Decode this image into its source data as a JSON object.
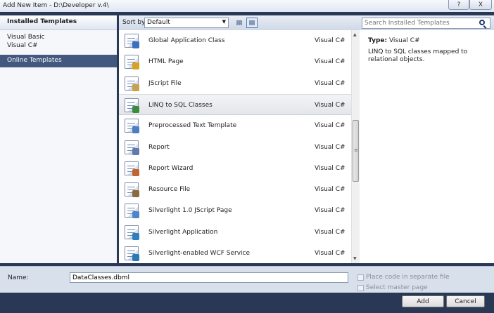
{
  "window": {
    "title": "Add New Item - D:\\Developer v.4\\",
    "help_label": "?",
    "close_label": "X"
  },
  "left_pane": {
    "installed_header": "Installed Templates",
    "tree": [
      "Visual Basic",
      "Visual C#"
    ],
    "online_templates": "Online Templates"
  },
  "sortbar": {
    "sort_label": "Sort by:",
    "sort_value": "Default"
  },
  "items": [
    {
      "name": "Global Application Class",
      "lang": "Visual C#",
      "icon": "global-app-icon"
    },
    {
      "name": "HTML Page",
      "lang": "Visual C#",
      "icon": "html-page-icon"
    },
    {
      "name": "JScript File",
      "lang": "Visual C#",
      "icon": "jscript-file-icon"
    },
    {
      "name": "LINQ to SQL Classes",
      "lang": "Visual C#",
      "icon": "linq-sql-icon"
    },
    {
      "name": "Preprocessed Text Template",
      "lang": "Visual C#",
      "icon": "text-template-icon"
    },
    {
      "name": "Report",
      "lang": "Visual C#",
      "icon": "report-icon"
    },
    {
      "name": "Report Wizard",
      "lang": "Visual C#",
      "icon": "report-wizard-icon"
    },
    {
      "name": "Resource File",
      "lang": "Visual C#",
      "icon": "resource-file-icon"
    },
    {
      "name": "Silverlight 1.0 JScript Page",
      "lang": "Visual C#",
      "icon": "silverlight-jscript-icon"
    },
    {
      "name": "Silverlight Application",
      "lang": "Visual C#",
      "icon": "silverlight-app-icon"
    },
    {
      "name": "Silverlight-enabled WCF Service",
      "lang": "Visual C#",
      "icon": "silverlight-wcf-icon"
    }
  ],
  "selected_index": 3,
  "search": {
    "placeholder": "Search Installed Templates"
  },
  "details": {
    "type_label": "Type:",
    "type_value": "Visual C#",
    "description": "LINQ to SQL classes mapped to relational objects."
  },
  "bottom": {
    "name_label": "Name:",
    "name_value": "DataClasses.dbml",
    "option1": "Place code in separate file",
    "option2": "Select master page"
  },
  "buttons": {
    "add": "Add",
    "cancel": "Cancel"
  },
  "colors": {
    "frame": "#293955",
    "selected_nav": "#42587e"
  }
}
